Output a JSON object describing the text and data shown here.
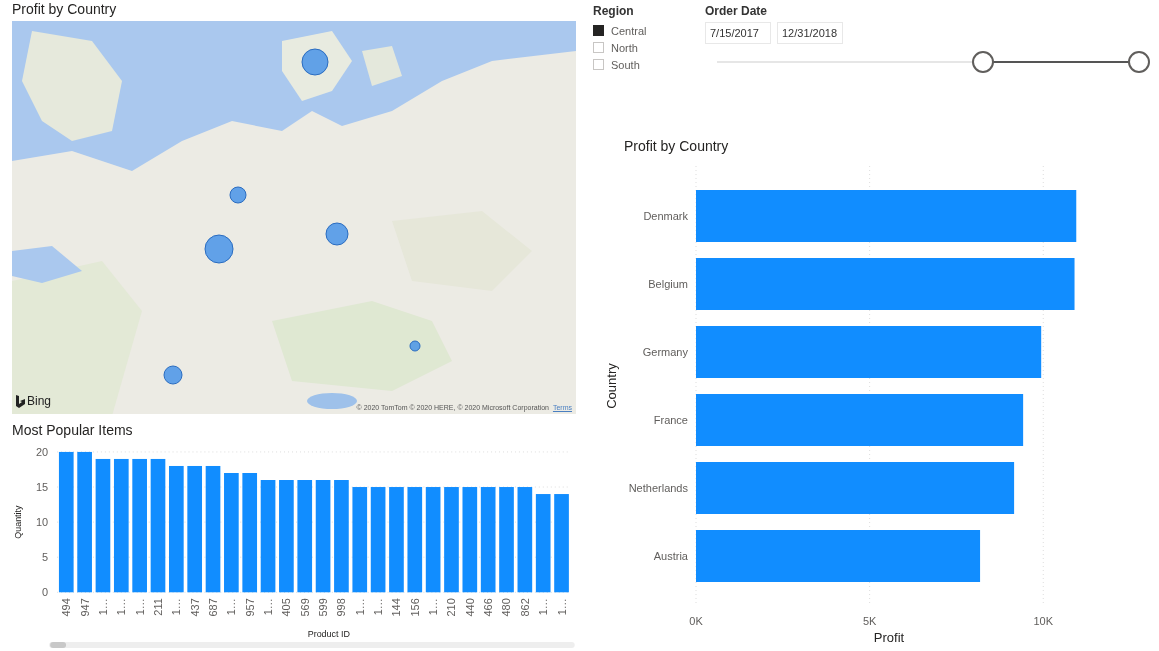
{
  "map": {
    "title": "Profit by Country",
    "provider": "Bing",
    "attribution": "© 2020 TomTom © 2020 HERE, © 2020 Microsoft Corporation",
    "terms_link": "Terms"
  },
  "items_chart": {
    "title": "Most Popular Items",
    "chart_data": {
      "type": "bar",
      "xlabel": "Product ID",
      "ylabel": "Quantity",
      "categories": [
        "494",
        "947",
        "1…",
        "1…",
        "1…",
        "211",
        "1…",
        "437",
        "687",
        "1…",
        "957",
        "1…",
        "405",
        "569",
        "599",
        "998",
        "1…",
        "1…",
        "144",
        "156",
        "1…",
        "210",
        "440",
        "466",
        "480",
        "862",
        "1…",
        "1…"
      ],
      "values": [
        20,
        20,
        19,
        19,
        19,
        19,
        18,
        18,
        18,
        17,
        17,
        16,
        16,
        16,
        16,
        16,
        15,
        15,
        15,
        15,
        15,
        15,
        15,
        15,
        15,
        15,
        14,
        14
      ],
      "ylim": [
        0,
        20
      ],
      "yticks": [
        0,
        5,
        10,
        15,
        20
      ],
      "grid": true
    }
  },
  "region_slicer": {
    "title": "Region",
    "options": [
      {
        "label": "Central",
        "checked": true
      },
      {
        "label": "North",
        "checked": false
      },
      {
        "label": "South",
        "checked": false
      }
    ]
  },
  "date_slicer": {
    "title": "Order Date",
    "start": "7/15/2017",
    "end": "12/31/2018",
    "low_thumb": {
      "level": 0.63
    },
    "high_thumb": {
      "level": 1
    }
  },
  "profit_chart": {
    "title": "Profit by Country",
    "chart_data": {
      "type": "bar",
      "orientation": "horizontal",
      "xlabel": "Profit",
      "ylabel": "Country",
      "categories": [
        "Denmark",
        "Belgium",
        "Germany",
        "France",
        "Netherlands",
        "Austria"
      ],
      "values": [
        10950,
        10900,
        9940,
        9420,
        9160,
        8180
      ],
      "xlim": [
        0,
        11000
      ],
      "grid": true,
      "xticks": [
        {
          "value": 0,
          "label": "0K"
        },
        {
          "value": 5000,
          "label": "5K"
        },
        {
          "value": 10000,
          "label": "10K"
        }
      ]
    }
  }
}
